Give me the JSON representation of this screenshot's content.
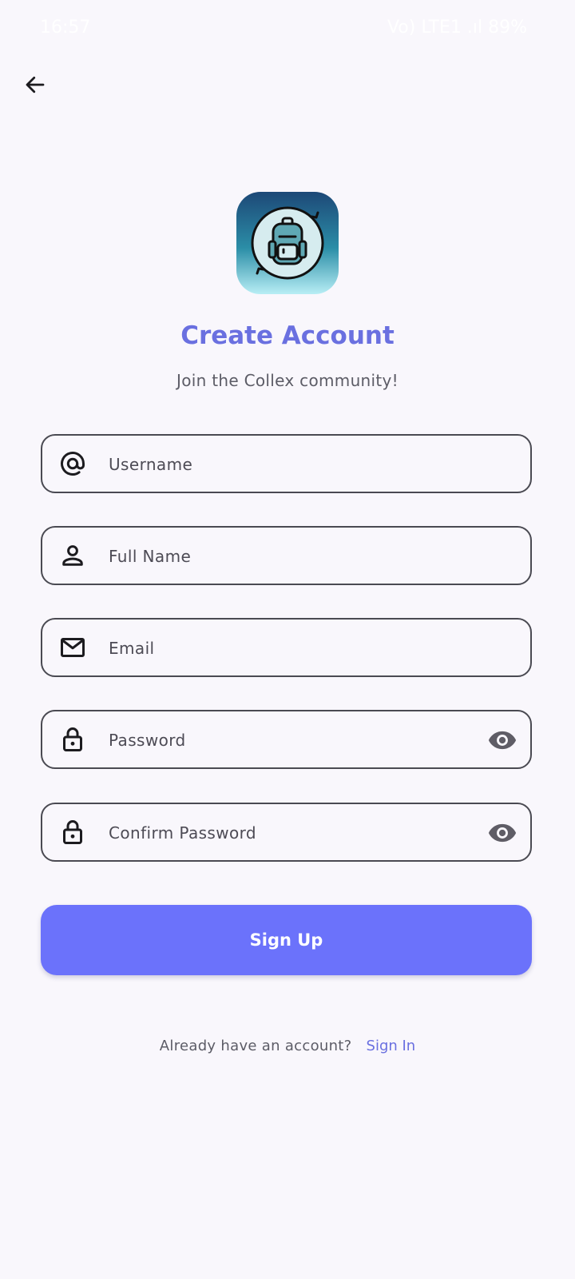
{
  "status_bar": {
    "time": "16:57",
    "right_text": "Vo) LTE1 .ıl 89%"
  },
  "header": {
    "back_icon": "arrow-left-icon"
  },
  "logo": {
    "icon": "backpack-logo"
  },
  "title": "Create Account",
  "subtitle": "Join the Collex community!",
  "form": {
    "username": {
      "placeholder": "Username",
      "icon": "at-sign-icon"
    },
    "full_name": {
      "placeholder": "Full Name",
      "icon": "person-icon"
    },
    "email": {
      "placeholder": "Email",
      "icon": "mail-icon"
    },
    "password": {
      "placeholder": "Password",
      "icon": "lock-icon",
      "toggle_icon": "eye-icon"
    },
    "confirm_password": {
      "placeholder": "Confirm Password",
      "icon": "lock-icon",
      "toggle_icon": "eye-icon"
    }
  },
  "signup_button": {
    "label": "Sign Up"
  },
  "footer": {
    "text": "Already have an account?",
    "link": "Sign In"
  },
  "colors": {
    "accent": "#6a70e0",
    "button": "#6b72fb",
    "background": "#f9f7fc"
  }
}
